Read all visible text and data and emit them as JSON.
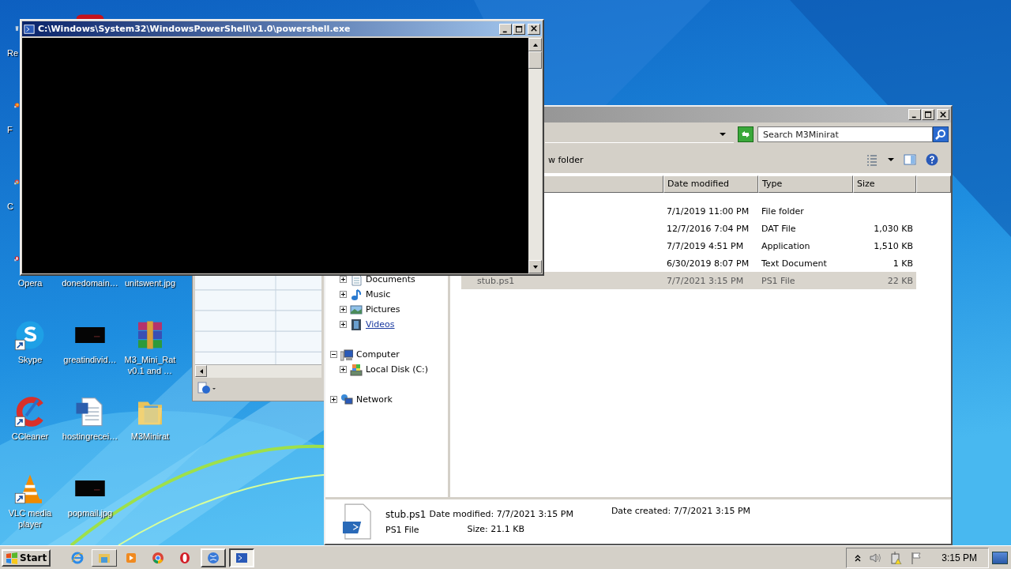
{
  "desktop": {
    "icon_columns": [
      {
        "icons": [
          {
            "kind": "recycle-bin",
            "label": "Re",
            "clipped": true,
            "icon_cut": true,
            "shortcut": false
          },
          {
            "kind": "firefox",
            "label": "F",
            "clipped": true,
            "icon_cut": true,
            "shortcut": true
          },
          {
            "kind": "chrome",
            "label": "C",
            "clipped": true,
            "icon_cut": true,
            "shortcut": true
          },
          {
            "kind": "opera",
            "label": "Opera",
            "clipped": false,
            "icon_cut": true,
            "shortcut": true
          },
          {
            "kind": "skype",
            "label": "Skype",
            "clipped": false,
            "shortcut": true
          },
          {
            "kind": "ccleaner",
            "label": "CCleaner",
            "clipped": false,
            "shortcut": true
          },
          {
            "kind": "vlc",
            "label": "VLC media player",
            "clipped": false,
            "shortcut": true
          }
        ]
      },
      {
        "icons": [
          {
            "kind": "red-app",
            "icon_cut": true
          },
          {
            "kind": "covered",
            "label": "donedomain…"
          },
          {
            "label": "greatindivid…"
          },
          {
            "kind": "word",
            "label": "hostingrecei…"
          },
          {
            "label": "popmail.jpg"
          }
        ]
      },
      {
        "icons": [
          {
            "kind": "covered",
            "label": "unitswent.jpg"
          },
          {
            "kind": "winrar",
            "label": "M3_Mini_Rat v0.1 and …"
          },
          {
            "kind": "folder",
            "label": "M3Minirat"
          }
        ]
      }
    ]
  },
  "powershell_window": {
    "title": "C:\\Windows\\System32\\WindowsPowerShell\\v1.0\\powershell.exe",
    "active": true
  },
  "explorer": {
    "search": {
      "placeholder": "Search M3Minirat"
    },
    "toolbar": {
      "new_folder": "w folder"
    },
    "columns": [
      "Date modified",
      "Type",
      "Size"
    ],
    "rows": [
      {
        "date": "7/1/2019 11:00 PM",
        "type": "File folder",
        "selected": false
      },
      {
        "date": "12/7/2016 7:04 PM",
        "type": "DAT File",
        "size": "1,030 KB",
        "selected": false
      },
      {
        "date": "7/7/2019 4:51 PM",
        "type": "Application",
        "size": "1,510 KB",
        "selected": false
      },
      {
        "date": "6/30/2019 8:07 PM",
        "type": "Text Document",
        "size": "1 KB",
        "selected": false
      },
      {
        "name": "stub.ps1",
        "date": "7/7/2021 3:15 PM",
        "type": "PS1 File",
        "size": "22 KB",
        "selected": true
      }
    ],
    "nav": [
      {
        "items": [
          {
            "kind": "documents",
            "label": "Documents",
            "hovered": false
          },
          {
            "kind": "music",
            "label": "Music",
            "hovered": false
          },
          {
            "kind": "pictures",
            "label": "Pictures",
            "hovered": false
          },
          {
            "kind": "videos",
            "label": "Videos",
            "hovered": true
          }
        ]
      },
      {
        "label": "Computer",
        "kind": "computer",
        "expanded": true,
        "children": [
          {
            "kind": "disk",
            "label": "Local Disk (C:)",
            "hovered": false
          }
        ]
      },
      {
        "label": "Network",
        "kind": "network",
        "expanded": false
      }
    ],
    "details": {
      "name": "stub.ps1",
      "type": "PS1 File",
      "date_modified": "Date modified: 7/7/2021 3:15 PM",
      "size": "Size: 21.1 KB",
      "date_created": "Date created: 7/7/2021 3:15 PM"
    }
  },
  "taskbar": {
    "start": "Start",
    "quick_launch": [
      {
        "kind": "ie",
        "hovered": false
      },
      {
        "kind": "explorer",
        "hovered": true
      },
      {
        "kind": "media",
        "hovered": false
      },
      {
        "kind": "chrome",
        "hovered": false
      },
      {
        "kind": "opera",
        "hovered": false
      }
    ],
    "tasks": [
      {
        "kind": "globe",
        "selected": false
      },
      {
        "kind": "powershell",
        "selected": true
      }
    ],
    "tray": {
      "time": "3:15 PM"
    }
  }
}
